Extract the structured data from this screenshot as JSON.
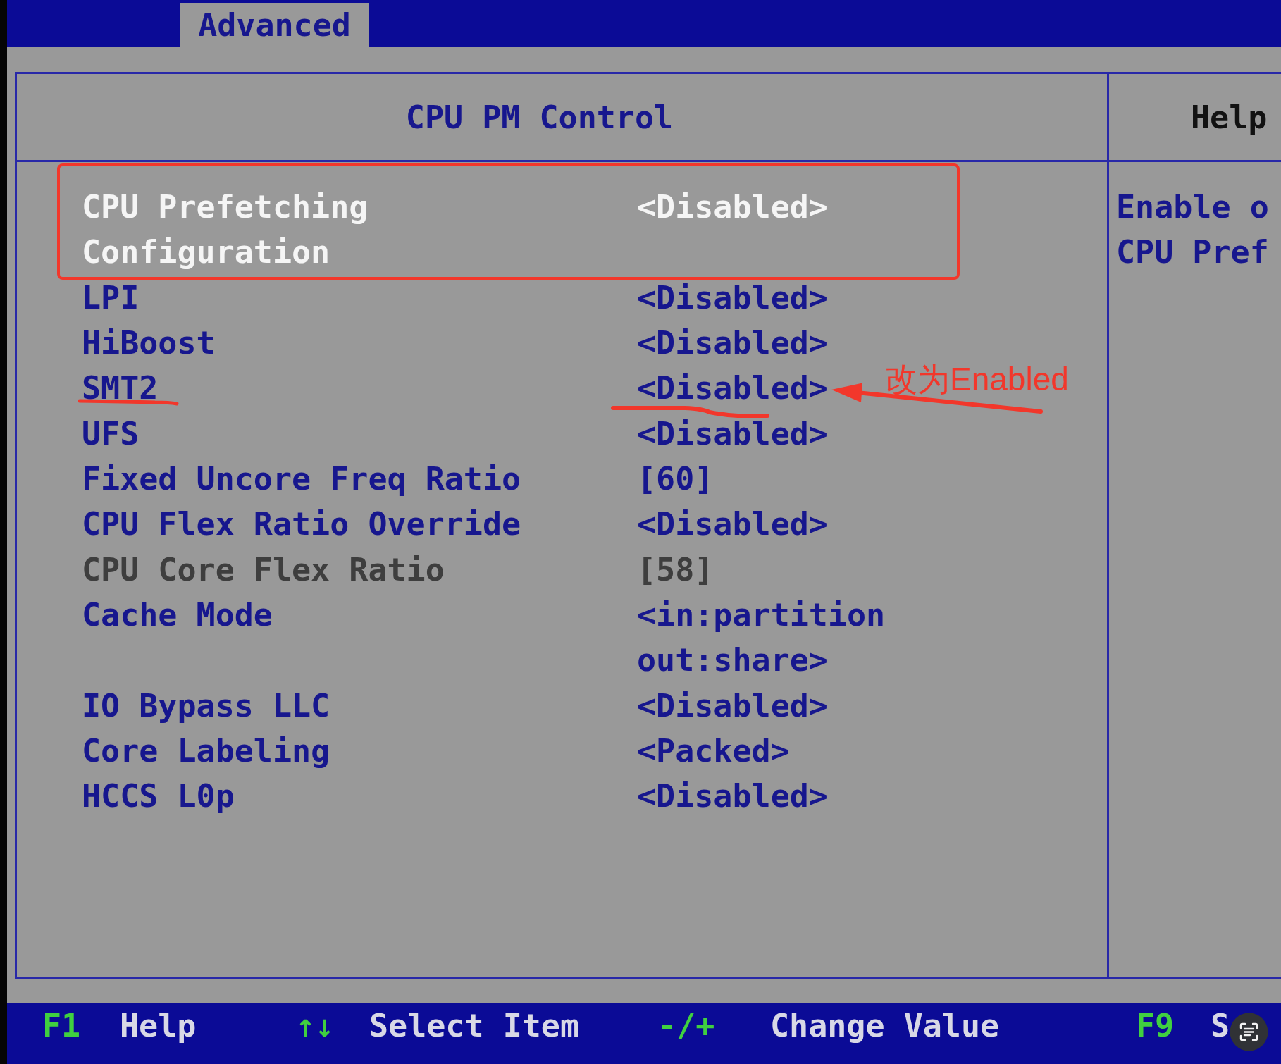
{
  "tabs": [
    {
      "label": "Advanced",
      "selected": true
    }
  ],
  "panel": {
    "title": "CPU PM Control",
    "rows": [
      {
        "label": "CPU Prefetching Configuration",
        "value": "<Disabled>",
        "selected": true,
        "disabled": false,
        "boxed": true,
        "underlined": false
      },
      {
        "label": "LPI",
        "value": "<Disabled>",
        "selected": false,
        "disabled": false,
        "boxed": false,
        "underlined": false
      },
      {
        "label": "HiBoost",
        "value": "<Disabled>",
        "selected": false,
        "disabled": false,
        "boxed": false,
        "underlined": false
      },
      {
        "label": "SMT2",
        "value": "<Disabled>",
        "selected": false,
        "disabled": false,
        "boxed": false,
        "underlined": true,
        "note": "改为Enabled"
      },
      {
        "label": "UFS",
        "value": "<Disabled>",
        "selected": false,
        "disabled": false,
        "boxed": false,
        "underlined": false
      },
      {
        "label": "Fixed Uncore Freq Ratio",
        "value": "[60]",
        "selected": false,
        "disabled": false,
        "boxed": false,
        "underlined": false
      },
      {
        "label": "CPU Flex Ratio Override",
        "value": "<Disabled>",
        "selected": false,
        "disabled": false,
        "boxed": false,
        "underlined": false
      },
      {
        "label": "CPU Core Flex Ratio",
        "value": "[58]",
        "selected": false,
        "disabled": true,
        "boxed": false,
        "underlined": false
      },
      {
        "label": "Cache Mode",
        "value": "<in:partition out:share>",
        "selected": false,
        "disabled": false,
        "boxed": false,
        "underlined": false
      },
      {
        "label": "IO Bypass LLC",
        "value": "<Disabled>",
        "selected": false,
        "disabled": false,
        "boxed": false,
        "underlined": false
      },
      {
        "label": "Core Labeling",
        "value": "<Packed>",
        "selected": false,
        "disabled": false,
        "boxed": false,
        "underlined": false
      },
      {
        "label": "HCCS L0p",
        "value": "<Disabled>",
        "selected": false,
        "disabled": false,
        "boxed": false,
        "underlined": false
      }
    ]
  },
  "help": {
    "title": "Help",
    "lines": [
      "Enable o",
      "CPU Pref"
    ]
  },
  "key_hints": [
    {
      "key": "F1",
      "action": "Help"
    },
    {
      "key": "↑↓",
      "action": "Select Item"
    },
    {
      "key": "-/+",
      "action": "Change Value"
    },
    {
      "key": "F9",
      "action": "S"
    }
  ]
}
